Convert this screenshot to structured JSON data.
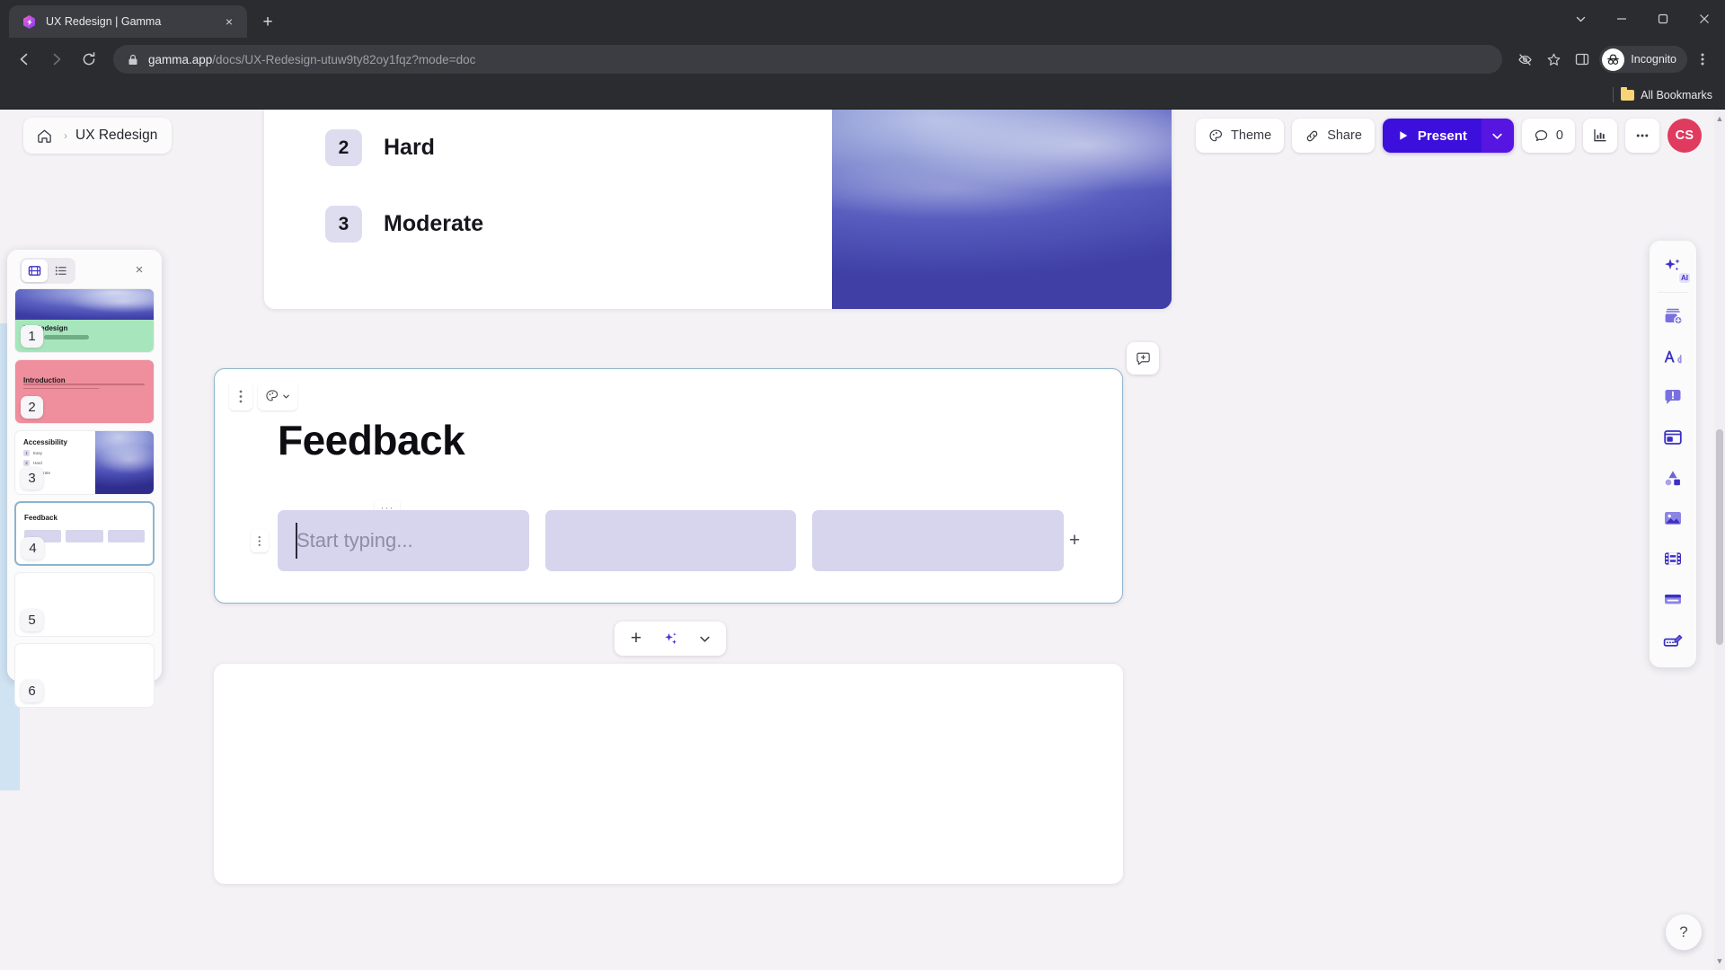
{
  "browser": {
    "tab": {
      "title": "UX Redesign | Gamma",
      "favicon": "gamma-logo-icon",
      "close": "×"
    },
    "new_tab_label": "+",
    "window": {
      "minimize": "—",
      "maximize": "restore-icon",
      "close": "✕",
      "tab_search": "chevron-down-icon"
    },
    "nav": {
      "back": "←",
      "forward": "→",
      "reload": "⟳"
    },
    "url": {
      "domain": "gamma.app",
      "path": "/docs/UX-Redesign-utuw9ty82oy1fqz?mode=doc",
      "lock": "lock-icon"
    },
    "omni_actions": {
      "tracking_protection": "eye-slash-icon",
      "bookmark": "star-icon",
      "side_panel": "side-panel-icon",
      "menu": "three-dot-menu-icon"
    },
    "profile": {
      "label": "Incognito",
      "icon": "incognito-icon"
    },
    "bookmarks": {
      "all_bookmarks": "All Bookmarks",
      "folder_icon": "folder-icon"
    }
  },
  "doc": {
    "home_icon": "home-icon",
    "breadcrumb_separator": "›",
    "title": "UX Redesign"
  },
  "toolbar": {
    "theme": "Theme",
    "theme_icon": "palette-icon",
    "share": "Share",
    "share_icon": "link-icon",
    "present": "Present",
    "present_icon": "play-icon",
    "present_caret": "chevron-down-icon",
    "comments_count": "0",
    "comments_icon": "comment-icon",
    "analytics_icon": "bar-chart-icon",
    "more_icon": "ellipsis-icon",
    "avatar_initials": "CS",
    "accent_purple": "#3d0fdd",
    "avatar_color": "#e03a5f"
  },
  "thumbnails": {
    "view_grid_icon": "grid-view-icon",
    "view_list_icon": "list-view-icon",
    "close_icon": "×",
    "slides": [
      {
        "number": "1",
        "title": "UX Redesign",
        "selected": false
      },
      {
        "number": "2",
        "title": "Introduction",
        "selected": false
      },
      {
        "number": "3",
        "title": "Accessibility",
        "selected": false
      },
      {
        "number": "4",
        "title": "Feedback",
        "selected": true
      },
      {
        "number": "5",
        "title": "",
        "selected": false
      },
      {
        "number": "6",
        "title": "",
        "selected": false
      }
    ],
    "slide3_rows": [
      {
        "badge": "1",
        "label": "Easy"
      },
      {
        "badge": "2",
        "label": "Hard"
      },
      {
        "badge": "3",
        "label": "Moderate"
      }
    ]
  },
  "card_above": {
    "rows": [
      {
        "badge": "2",
        "label": "Hard"
      },
      {
        "badge": "3",
        "label": "Moderate"
      }
    ]
  },
  "feedback_card": {
    "drag_handle_icon": "vertical-dots-icon",
    "palette_icon": "palette-icon",
    "palette_caret": "chevron-down-icon",
    "title": "Feedback",
    "columns_handle_icon": "vertical-dots-icon",
    "columns_menu": "···",
    "add_column": "+",
    "comment_icon": "add-comment-icon",
    "columns": [
      {
        "placeholder": "Start typing...",
        "focused": true
      },
      {
        "placeholder": "",
        "focused": false
      },
      {
        "placeholder": "",
        "focused": false
      }
    ],
    "column_bg": "#d6d5ed",
    "border_color": "#8fb4cd"
  },
  "insert_bar": {
    "add": "+",
    "ai_icon": "ai-sparkle-icon",
    "more_icon": "chevron-down-icon"
  },
  "rail": {
    "items": [
      {
        "icon": "ai-sparkle-icon",
        "tag": "AI"
      },
      {
        "icon": "add-card-icon",
        "tag": ""
      },
      {
        "icon": "text-icon",
        "tag": ""
      },
      {
        "icon": "callout-icon",
        "tag": ""
      },
      {
        "icon": "layout-icon",
        "tag": ""
      },
      {
        "icon": "shapes-icon",
        "tag": ""
      },
      {
        "icon": "image-icon",
        "tag": ""
      },
      {
        "icon": "video-icon",
        "tag": ""
      },
      {
        "icon": "embed-icon",
        "tag": ""
      },
      {
        "icon": "drawing-icon",
        "tag": ""
      }
    ]
  },
  "help": {
    "label": "?"
  }
}
